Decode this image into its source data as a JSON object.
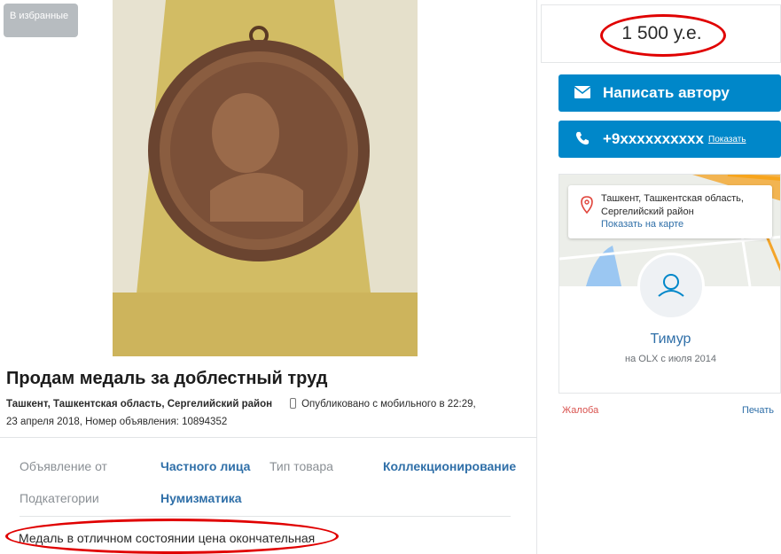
{
  "favorite_label": "В избранные",
  "listing": {
    "title": "Продам медаль за доблестный труд",
    "location": "Ташкент, Ташкентская область, Сергелийский район",
    "published_mobile": "Опубликовано с мобильного",
    "published_time": "в 22:29,",
    "published_date_line": "23 апреля 2018, Номер объявления: 10894352"
  },
  "details": {
    "offer_from_label": "Объявление от",
    "offer_from_value": "Частного лица",
    "product_type_label": "Тип товара",
    "product_type_value": "Коллекционирование",
    "subcategory_label": "Подкатегории",
    "subcategory_value": "Нумизматика"
  },
  "description": "Медаль в отличном состоянии цена окончательная",
  "price": "1 500 у.е.",
  "buttons": {
    "write_author": "Написать автору",
    "phone_masked": "+9xxxxxxxxxx",
    "phone_show": "Показать"
  },
  "seller": {
    "address": "Ташкент, Ташкентская область, Сергелийский район",
    "show_on_map": "Показать на карте",
    "name": "Тимур",
    "since": "на OLX с июля 2014"
  },
  "footer_links": {
    "complain": "Жалоба",
    "print": "Печать"
  },
  "colors": {
    "accent": "#0087c9",
    "link": "#2f6fa8",
    "annotation": "#e00000"
  },
  "icons": [
    "heart-icon",
    "mail-icon",
    "phone-icon",
    "mobile-icon",
    "map-pin-icon",
    "user-icon"
  ]
}
